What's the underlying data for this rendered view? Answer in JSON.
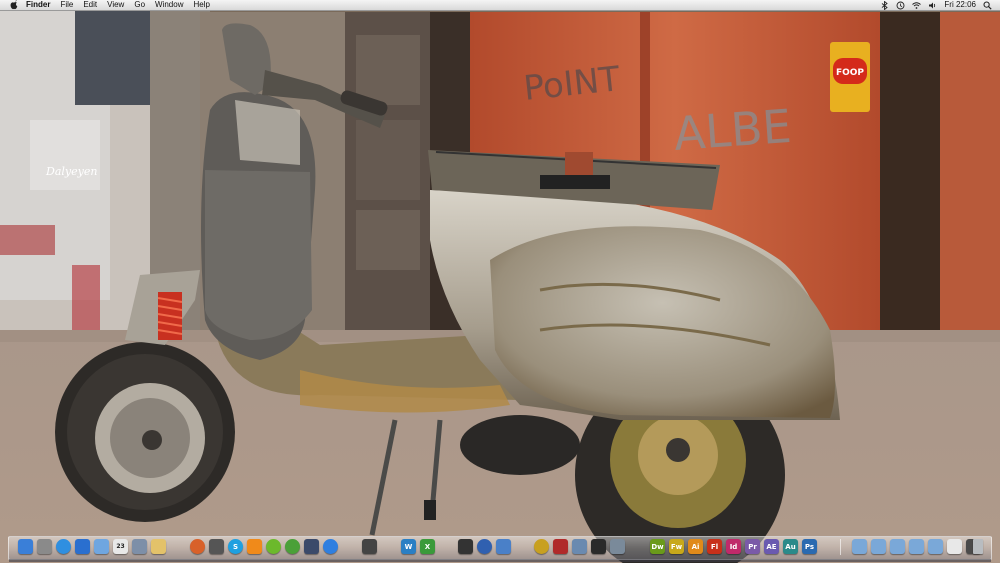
{
  "menubar": {
    "app_name": "Finder",
    "menus": [
      "File",
      "Edit",
      "View",
      "Go",
      "Window",
      "Help"
    ],
    "clock": "Fri 22:06"
  },
  "wallpaper": {
    "signature": "Dalyeyen",
    "poster_text": "FOOP",
    "graffiti_left": "PoINT",
    "graffiti_right": "ALBE"
  },
  "dock": {
    "apps": [
      {
        "name": "finder-icon",
        "label": "",
        "color": "#3a7fd8"
      },
      {
        "name": "system-preferences-icon",
        "label": "",
        "color": "#8a8a8a"
      },
      {
        "name": "safari-icon",
        "label": "",
        "color": "#2f8fe0"
      },
      {
        "name": "itunes-icon",
        "label": "",
        "color": "#2a6fcf"
      },
      {
        "name": "mail-icon",
        "label": "",
        "color": "#6fa6e0"
      },
      {
        "name": "calendar-icon",
        "label": "23",
        "color": "#e8e8e8"
      },
      {
        "name": "preview-icon",
        "label": "",
        "color": "#7d8fa8"
      },
      {
        "name": "notes-icon",
        "label": "",
        "color": "#e3c26a"
      },
      {
        "name": "firefox-icon",
        "label": "",
        "color": "#d8612a"
      },
      {
        "name": "camera-icon",
        "label": "",
        "color": "#555555"
      },
      {
        "name": "skype-icon",
        "label": "S",
        "color": "#1ea0e0"
      },
      {
        "name": "vlc-icon",
        "label": "",
        "color": "#f08a1a"
      },
      {
        "name": "spotify-icon",
        "label": "",
        "color": "#6cb92c"
      },
      {
        "name": "utorrent-icon",
        "label": "",
        "color": "#4aa038"
      },
      {
        "name": "messenger-icon",
        "label": "",
        "color": "#3b4a6a"
      },
      {
        "name": "app-store-icon",
        "label": "",
        "color": "#2f7fe0"
      },
      {
        "name": "terminal-icon",
        "label": "",
        "color": "#444444"
      },
      {
        "name": "word-icon",
        "label": "W",
        "color": "#2a7fc4"
      },
      {
        "name": "excel-icon",
        "label": "X",
        "color": "#3a9a3a"
      },
      {
        "name": "movie-icon",
        "label": "",
        "color": "#333333"
      },
      {
        "name": "network-icon",
        "label": "",
        "color": "#3060b0"
      },
      {
        "name": "xcode-icon",
        "label": "",
        "color": "#4a80c8"
      },
      {
        "name": "keychain-icon",
        "label": "",
        "color": "#c8a020"
      },
      {
        "name": "photo-booth-icon",
        "label": "",
        "color": "#b02a2a"
      },
      {
        "name": "iphoto-icon",
        "label": "",
        "color": "#6a8ab0"
      },
      {
        "name": "activity-monitor-icon",
        "label": "",
        "color": "#2a2a2a"
      },
      {
        "name": "utilities-icon",
        "label": "",
        "color": "#7a8a9a"
      },
      {
        "name": "dreamweaver-icon",
        "label": "Dw",
        "color": "#6a9a1a"
      },
      {
        "name": "fireworks-icon",
        "label": "Fw",
        "color": "#c8a81a"
      },
      {
        "name": "illustrator-icon",
        "label": "Ai",
        "color": "#e08a1a"
      },
      {
        "name": "flash-icon",
        "label": "Fl",
        "color": "#c8301a"
      },
      {
        "name": "indesign-icon",
        "label": "Id",
        "color": "#c02a6a"
      },
      {
        "name": "premiere-icon",
        "label": "Pr",
        "color": "#7a5aa8"
      },
      {
        "name": "after-effects-icon",
        "label": "AE",
        "color": "#6a5ab0"
      },
      {
        "name": "audition-icon",
        "label": "Au",
        "color": "#2a8a8a"
      },
      {
        "name": "photoshop-icon",
        "label": "Ps",
        "color": "#2a6ab0"
      }
    ],
    "folders": [
      {
        "name": "folder-icon",
        "color": "#7aa8d8"
      },
      {
        "name": "folder-icon",
        "color": "#7aa8d8"
      },
      {
        "name": "folder-icon",
        "color": "#7aa8d8"
      },
      {
        "name": "folder-icon",
        "color": "#7aa8d8"
      },
      {
        "name": "folder-icon",
        "color": "#7aa8d8"
      },
      {
        "name": "document-icon",
        "color": "#e8e8e8"
      },
      {
        "name": "drive-icon",
        "color": "#4a4a4a"
      },
      {
        "name": "trash-icon",
        "color": "#b8bcc0"
      }
    ]
  }
}
